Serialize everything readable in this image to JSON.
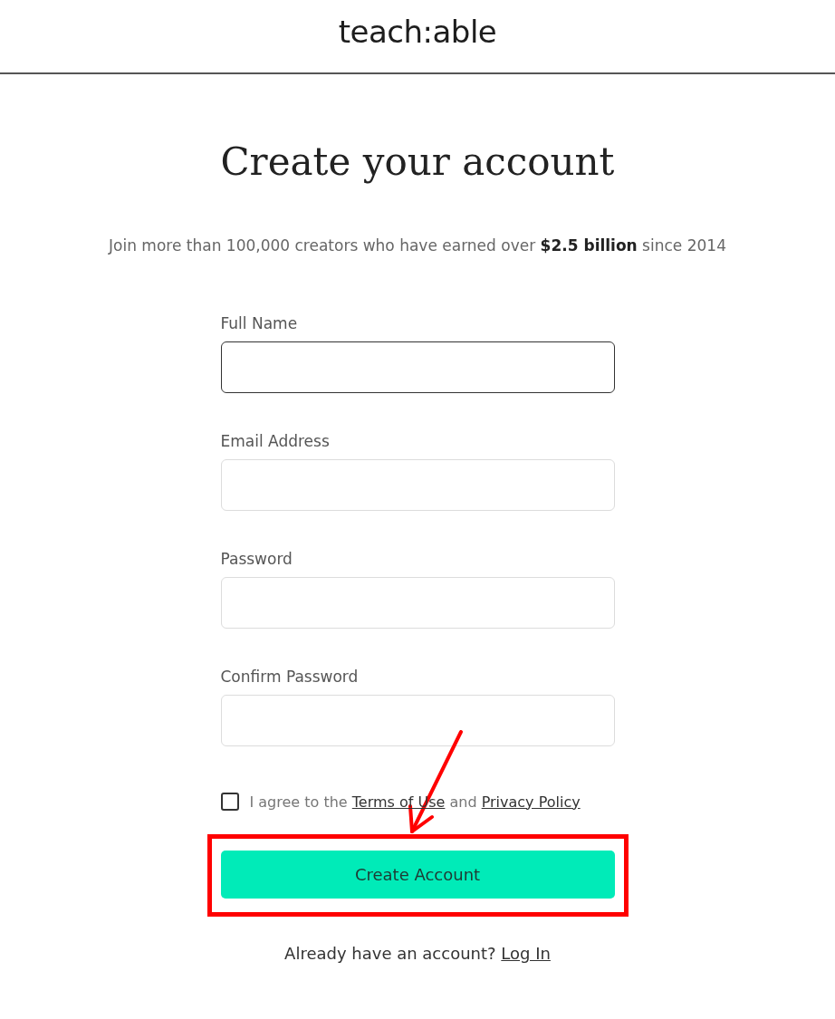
{
  "header": {
    "logo": "teach:able"
  },
  "title": "Create your account",
  "subtitle": "Join more than 100,000 creators who have earned over **$2.5 billion** since 2014",
  "fields": [
    {
      "label": "Full Name",
      "focused": true
    },
    {
      "label": "Email Address",
      "focused": false
    },
    {
      "label": "Password",
      "focused": false
    },
    {
      "label": "Confirm Password",
      "focused": false
    }
  ],
  "agreement": {
    "checked": false,
    "prefix": "I agree to the",
    "terms_link": "Terms of Use",
    "joiner": "and",
    "privacy_link": "Privacy Policy"
  },
  "submit_button": "Create Account",
  "login": {
    "prompt": "Already have an account?",
    "link": "Log In"
  },
  "annotations": {
    "highlight_frame": true,
    "arrow": true
  }
}
